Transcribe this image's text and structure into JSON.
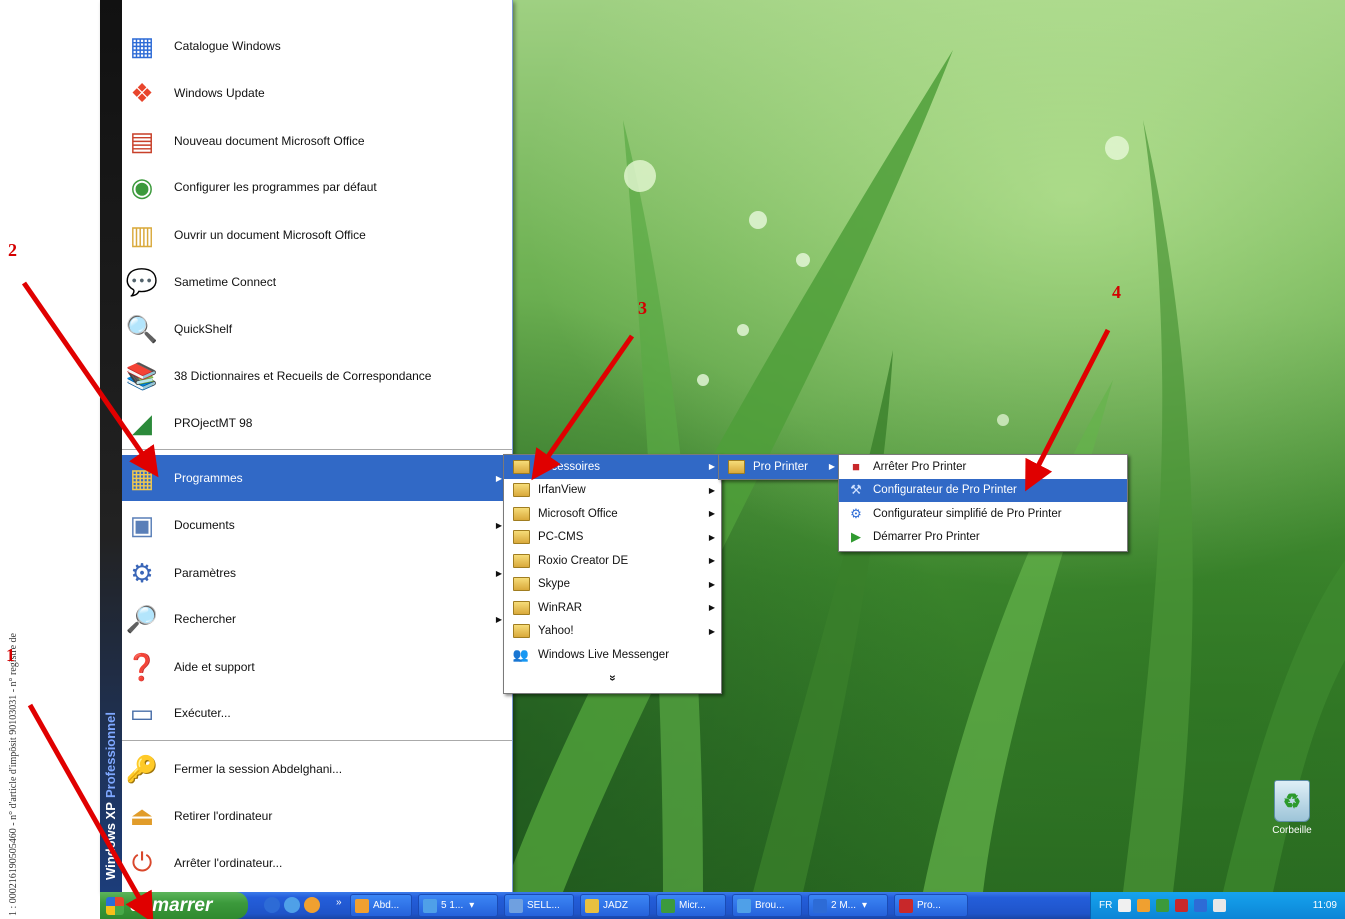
{
  "margin_note": "1 : 000216190505460 - n° d'article d'impôsit        90103031 - n° registre de",
  "start_menu": {
    "band_os": "Windows XP",
    "band_edition": "Professionnel",
    "pinned": [
      {
        "label": "Catalogue Windows",
        "icon": "catalog-icon"
      },
      {
        "label": "Windows Update",
        "icon": "windows-update-icon"
      },
      {
        "label": "Nouveau document Microsoft Office",
        "icon": "office-new-icon"
      },
      {
        "label": "Configurer les programmes par défaut",
        "icon": "default-programs-icon"
      },
      {
        "label": "Ouvrir un document Microsoft Office",
        "icon": "office-open-icon"
      },
      {
        "label": "Sametime Connect",
        "icon": "chat-icon"
      },
      {
        "label": "QuickShelf",
        "icon": "quickshelf-icon"
      },
      {
        "label": "38 Dictionnaires et Recueils de Correspondance",
        "icon": "books-icon"
      },
      {
        "label": "PROjectMT 98",
        "icon": "project-icon"
      }
    ],
    "system": [
      {
        "label": "Programmes",
        "icon": "programs-icon",
        "arrow": true,
        "selected": true
      },
      {
        "label": "Documents",
        "icon": "documents-icon",
        "arrow": true
      },
      {
        "label": "Paramètres",
        "icon": "settings-icon",
        "arrow": true
      },
      {
        "label": "Rechercher",
        "icon": "search-icon",
        "arrow": true
      },
      {
        "label": "Aide et support",
        "icon": "help-icon"
      },
      {
        "label": "Exécuter...",
        "icon": "run-icon"
      },
      {
        "label": "Fermer la session Abdelghani...",
        "icon": "logoff-icon"
      },
      {
        "label": "Retirer l'ordinateur",
        "icon": "eject-icon"
      },
      {
        "label": "Arrêter l'ordinateur...",
        "icon": "shutdown-icon"
      }
    ]
  },
  "programs_menu": [
    {
      "label": "Accessoires",
      "arrow": true,
      "selected": true
    },
    {
      "label": "IrfanView",
      "arrow": true
    },
    {
      "label": "Microsoft Office",
      "arrow": true
    },
    {
      "label": "PC-CMS",
      "arrow": true
    },
    {
      "label": "Roxio Creator DE",
      "arrow": true
    },
    {
      "label": "Skype",
      "arrow": true
    },
    {
      "label": "WinRAR",
      "arrow": true
    },
    {
      "label": "Yahoo!",
      "arrow": true
    },
    {
      "label": "Windows Live Messenger",
      "arrow": false
    }
  ],
  "programs_more": "»",
  "accessories_menu": [
    {
      "label": "Pro Printer",
      "arrow": true,
      "selected": true
    }
  ],
  "proprinter_menu": [
    {
      "label": "Arrêter Pro Printer",
      "icon": "stop-icon"
    },
    {
      "label": "Configurateur de Pro Printer",
      "icon": "config-icon",
      "selected": true
    },
    {
      "label": "Configurateur simplifié de Pro Printer",
      "icon": "config-simple-icon"
    },
    {
      "label": "Démarrer Pro Printer",
      "icon": "start-icon"
    }
  ],
  "taskbar": {
    "start_label": "démarrer",
    "quick_launch_more": "»",
    "buttons": [
      "Abd...",
      "5 1...",
      "SELL...",
      "JADZ",
      "Micr...",
      "Brou...",
      "2 M...",
      "Pro..."
    ],
    "language": "FR",
    "clock": "11:09"
  },
  "desktop": {
    "recycle_label": "Corbeille"
  },
  "annotations": [
    "1",
    "2",
    "3",
    "4"
  ],
  "colors": {
    "highlight": "#3169c6",
    "arrow": "#e00000",
    "taskbar": "#245edb",
    "start": "#3c9a3c"
  }
}
